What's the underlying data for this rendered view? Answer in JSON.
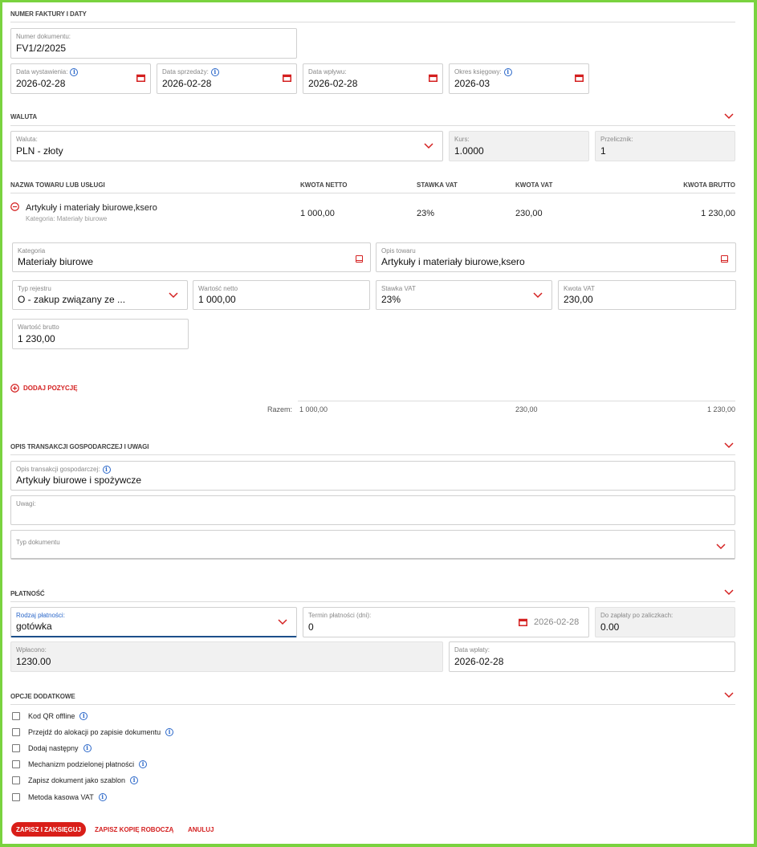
{
  "section_invoice": {
    "title": "NUMER FAKTURY I DATY",
    "doc_number": {
      "label": "Numer dokumentu:",
      "value": "FV1/2/2025"
    },
    "issue_date": {
      "label": "Data wystawienia:",
      "value": "2026-02-28"
    },
    "sale_date": {
      "label": "Data sprzedaży:",
      "value": "2026-02-28"
    },
    "receipt_date": {
      "label": "Data wpływu:",
      "value": "2026-02-28"
    },
    "accounting_period": {
      "label": "Okres księgowy:",
      "value": "2026-03"
    }
  },
  "section_currency": {
    "title": "WALUTA",
    "currency": {
      "label": "Waluta:",
      "value": "PLN - złoty"
    },
    "rate": {
      "label": "Kurs:",
      "value": "1.0000"
    },
    "converter": {
      "label": "Przelicznik:",
      "value": "1"
    }
  },
  "items_table": {
    "headers": {
      "name": "NAZWA TOWARU LUB USŁUGI",
      "net": "KWOTA NETTO",
      "vat_rate": "STAWKA VAT",
      "vat": "KWOTA VAT",
      "gross": "KWOTA BRUTTO"
    },
    "row": {
      "name": "Artykuły i materiały biurowe,ksero",
      "category_sub": "Kategoria: Materiały biurowe",
      "net": "1 000,00",
      "vat_rate": "23%",
      "vat": "230,00",
      "gross": "1 230,00"
    },
    "detail": {
      "category": {
        "label": "Kategoria",
        "value": "Materiały biurowe"
      },
      "description": {
        "label": "Opis towaru",
        "value": "Artykuły i materiały biurowe,ksero"
      },
      "register_type": {
        "label": "Typ rejestru",
        "value": "O - zakup związany ze ..."
      },
      "net_value": {
        "label": "Wartość netto",
        "value": "1 000,00"
      },
      "vat_rate": {
        "label": "Stawka VAT",
        "value": "23%"
      },
      "vat_amount": {
        "label": "Kwota VAT",
        "value": "230,00"
      },
      "gross_value": {
        "label": "Wartość brutto",
        "value": "1 230,00"
      }
    },
    "add_position": "DODAJ POZYCJĘ",
    "totals": {
      "label": "Razem:",
      "net": "1 000,00",
      "vat": "230,00",
      "gross": "1 230,00"
    }
  },
  "section_description": {
    "title": "OPIS TRANSAKCJI GOSPODARCZEJ I UWAGI",
    "transaction": {
      "label": "Opis transakcji gospodarczej:",
      "value": "Artykuły biurowe i spożywcze"
    },
    "notes": {
      "label": "Uwagi:",
      "value": ""
    },
    "doc_type": {
      "label": "Typ dokumentu",
      "value": ""
    }
  },
  "section_payment": {
    "title": "PŁATNOŚĆ",
    "method": {
      "label": "Rodzaj płatności:",
      "value": "gotówka"
    },
    "term": {
      "label": "Termin płatności (dni):",
      "value": "0",
      "date": "2026-02-28"
    },
    "due_after_advances": {
      "label": "Do zapłaty po zaliczkach:",
      "value": "0.00"
    },
    "paid": {
      "label": "Wpłacono:",
      "value": "1230.00"
    },
    "payment_date": {
      "label": "Data wpłaty:",
      "value": "2026-02-28"
    }
  },
  "section_options": {
    "title": "OPCJE DODATKOWE",
    "options": [
      "Kod QR offline",
      "Przejdź do alokacji po zapisie dokumentu",
      "Dodaj następny",
      "Mechanizm podzielonej płatności",
      "Zapisz dokument jako szablon",
      "Metoda kasowa VAT"
    ]
  },
  "actions": {
    "save_post": "ZAPISZ I ZAKSIĘGUJ",
    "save_draft": "ZAPISZ KOPIĘ ROBOCZĄ",
    "cancel": "ANULUJ"
  },
  "colors": {
    "accent": "#d42020",
    "info": "#2a67c9",
    "frame": "#7ad33f"
  }
}
